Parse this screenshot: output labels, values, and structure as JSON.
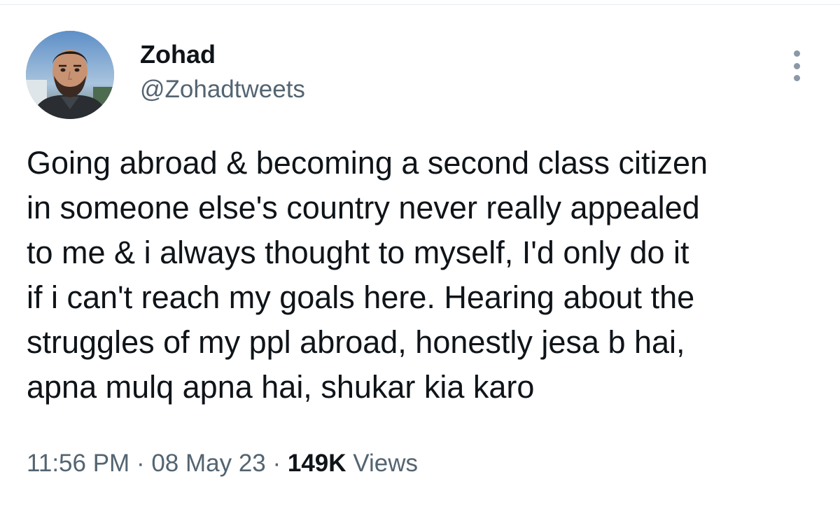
{
  "tweet": {
    "author": {
      "display_name": "Zohad",
      "handle": "@Zohadtweets"
    },
    "text": "Going abroad & becoming a second class citizen\nin someone else's country never really appealed\nto me & i always thought to myself, I'd only do it\nif i can't reach my goals here. Hearing about the\nstruggles of my ppl abroad, honestly jesa b hai,\napna mulq apna hai, shukar kia karo",
    "time": "11:56 PM",
    "date": "08 May 23",
    "separator": " · ",
    "views_count": "149K",
    "views_label": " Views"
  },
  "icons": {
    "more": "more-options-icon",
    "avatar": "profile-photo"
  },
  "colors": {
    "primary_text": "#0f1419",
    "secondary_text": "#536471",
    "more_dots": "#8b98a5"
  }
}
